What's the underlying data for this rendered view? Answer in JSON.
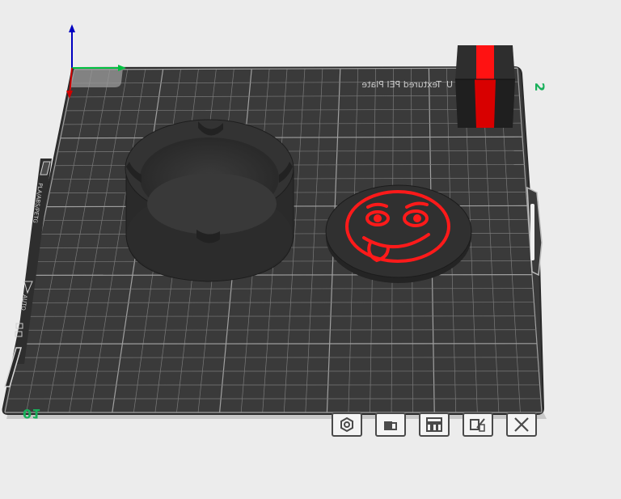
{
  "plate": {
    "label": "Textured PEI Plate",
    "label_prefix": "U",
    "number": "01",
    "side_number": "2",
    "filament_type": "PLA/ABS/PETG",
    "slot_label": "AUTO"
  },
  "scene_objects": [
    {
      "name": "ashtray",
      "color": "#2a2a2a"
    },
    {
      "name": "emoji-coaster",
      "color": "#2a2a2a",
      "accent": "#ff1a1a"
    },
    {
      "name": "cube",
      "color": "#242424",
      "accent": "#e00000"
    }
  ],
  "colors": {
    "plate": "#3a3a3a",
    "grid": "#8a8a8a",
    "accent_red": "#ff1a1a",
    "axis_x": "#00c040",
    "axis_y": "#d00000",
    "axis_z": "#0000c0",
    "label_green": "#18b05a"
  },
  "toolbar": [
    {
      "name": "settings-button",
      "icon": "gear-icon"
    },
    {
      "name": "lock-button",
      "icon": "lock-icon"
    },
    {
      "name": "arrange-button",
      "icon": "arrange-icon"
    },
    {
      "name": "edit-plate-button",
      "icon": "edit-plate-icon"
    },
    {
      "name": "delete-plate-button",
      "icon": "close-icon"
    }
  ]
}
